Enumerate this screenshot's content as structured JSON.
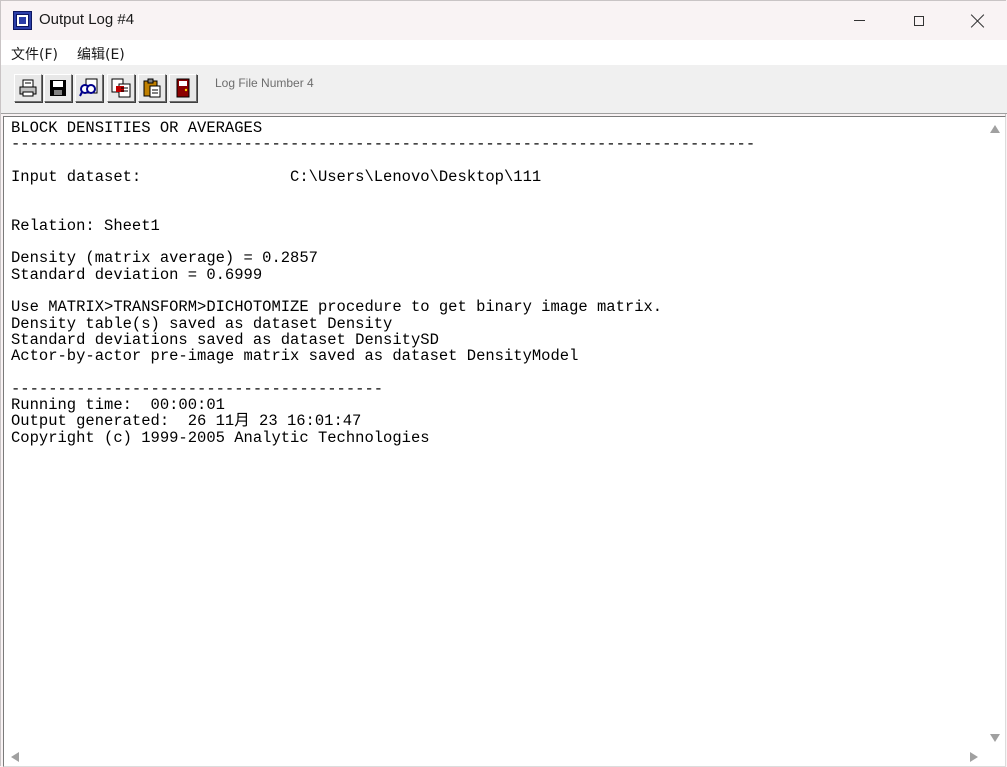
{
  "window": {
    "title": "Output Log #4",
    "app_icon": "ucinet-app-icon",
    "controls": [
      "minimize-icon",
      "maximize-icon",
      "close-icon"
    ]
  },
  "menu": {
    "file_label": "文件(F)",
    "edit_label": "编辑(E)"
  },
  "toolbar": {
    "buttons": [
      "print-icon",
      "save-icon",
      "find-icon",
      "copy-icon",
      "paste-icon",
      "exit-icon"
    ],
    "log_label": "Log File Number 4"
  },
  "log": {
    "lines": [
      "BLOCK DENSITIES OR AVERAGES",
      "--------------------------------------------------------------------------------",
      "",
      "Input dataset:                C:\\Users\\Lenovo\\Desktop\\111",
      "",
      "",
      "Relation: Sheet1",
      "",
      "Density (matrix average) = 0.2857",
      "Standard deviation = 0.6999",
      "",
      "Use MATRIX>TRANSFORM>DICHOTOMIZE procedure to get binary image matrix.",
      "Density table(s) saved as dataset Density",
      "Standard deviations saved as dataset DensitySD",
      "Actor-by-actor pre-image matrix saved as dataset DensityModel",
      "",
      "----------------------------------------",
      "Running time:  00:00:01",
      "Output generated:  26 11月 23 16:01:47",
      "Copyright (c) 1999-2005 Analytic Technologies"
    ]
  },
  "colors": {
    "titlebar_bg": "#f9f3f4",
    "toolbar_bg": "#f0f0f0",
    "text_bg": "#ffffff",
    "scroll_arrow": "#a0a0a0"
  }
}
